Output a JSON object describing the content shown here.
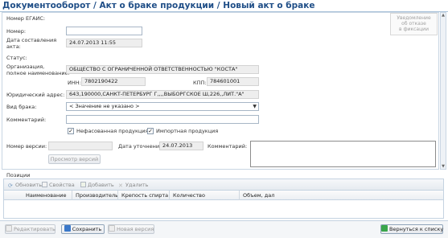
{
  "title": "Документооборот / Акт о браке продукции / Новый акт о браке",
  "form": {
    "egais_label": "Номер ЕГАИС:",
    "number_label": "Номер:",
    "number_value": "",
    "date_label_line1": "Дата составления",
    "date_label_line2": "акта:",
    "date_value": "24.07.2013 11:55",
    "status_label": "Статус:",
    "org_label_line1": "Организация,",
    "org_label_line2": "полное наименование:",
    "org_value": "ОБЩЕСТВО С ОГРАНИЧЕННОЙ ОТВЕТСТВЕННОСТЬЮ \"КОСТА\"",
    "inn_label": "ИНН:",
    "inn_value": "7802190422",
    "kpp_label": "КПП:",
    "kpp_value": "784601001",
    "address_label": "Юридический адрес:",
    "address_value": "643,190000,САНКТ-ПЕТЕРБУРГ Г,,,,ВЫБОРГСКОЕ Ш,226,,ЛИТ.\"А\"",
    "defect_label": "Вид брака:",
    "defect_value": "< Значение не указано >",
    "comment_label": "Комментарий:",
    "comment_value": "",
    "unpacked_label": "Нефасованная продукция",
    "unpacked_checked": "✓",
    "imported_label": "Импортная продукция",
    "imported_checked": "✓",
    "version_label": "Номер версии:",
    "refine_date_label": "Дата уточнения:",
    "refine_date_value": "24.07.2013",
    "version_comment_label": "Комментарий:",
    "view_versions_button": "Просмотр версий"
  },
  "notify_button": {
    "line1": "Уведомление",
    "line2": "об отказе",
    "line3": "в фиксации"
  },
  "positions": {
    "section_label": "Позиции",
    "toolbar": {
      "refresh": "Обновить",
      "properties": "Свойства",
      "add": "Добавить",
      "delete": "Удалить"
    },
    "columns": [
      "Наименование",
      "Производитель",
      "Крепость спирта",
      "Количество",
      "Объем, дал"
    ]
  },
  "bottom_bar": {
    "edit": "Редактировать",
    "save": "Сохранить",
    "new_version": "Новая версия",
    "back": "Вернуться к списку"
  },
  "colors": {
    "title": "#1f4e87",
    "save_icon": "#3a78c9",
    "back_icon": "#3aa64b"
  }
}
